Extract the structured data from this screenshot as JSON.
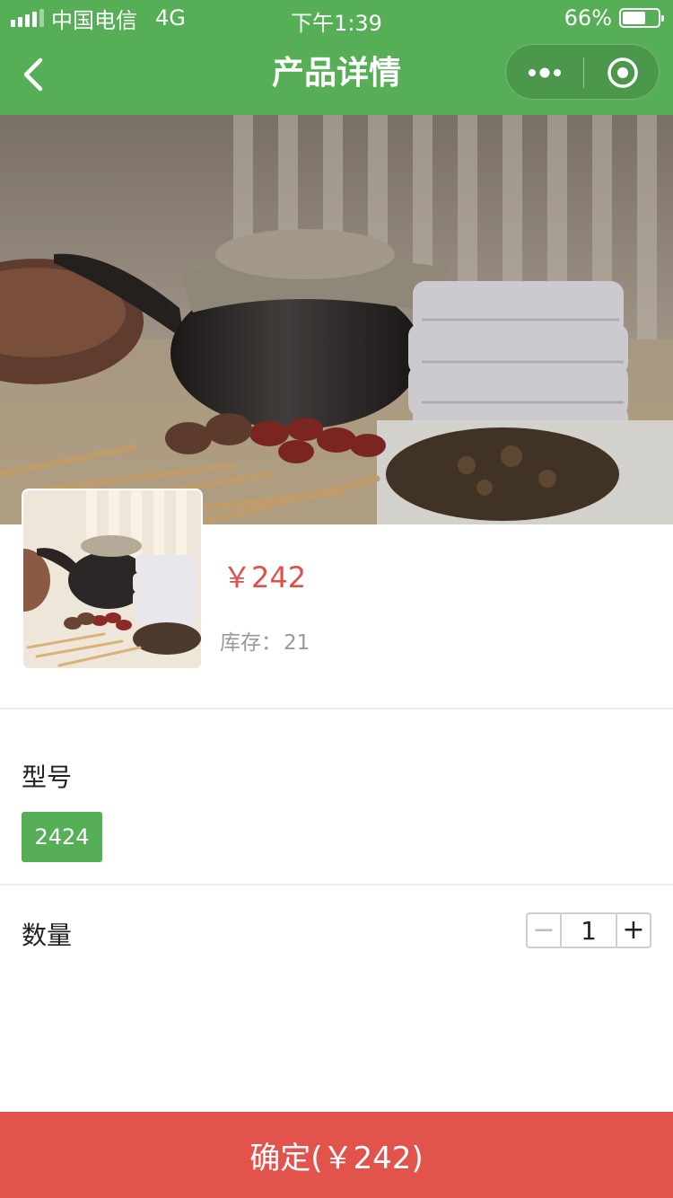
{
  "status_bar": {
    "carrier": "中国电信",
    "network": "4G",
    "time": "下午1:39",
    "battery_text": "66%",
    "battery_level": 0.66
  },
  "nav": {
    "title": "产品详情",
    "back_icon": "chevron-left-icon",
    "more_icon": "more-dots-icon",
    "close_icon": "target-circle-icon",
    "bar_color": "#56ae57"
  },
  "product": {
    "price": "￥242",
    "stock_label": "库存：",
    "stock_value": "21",
    "price_color": "#e0504a"
  },
  "spec": {
    "model_label": "型号",
    "model_option": "2424",
    "quantity_label": "数量",
    "quantity_value": "1",
    "minus": "−",
    "plus": "+"
  },
  "footer": {
    "confirm_label": "确定(￥242)",
    "confirm_color": "#e2534b"
  }
}
